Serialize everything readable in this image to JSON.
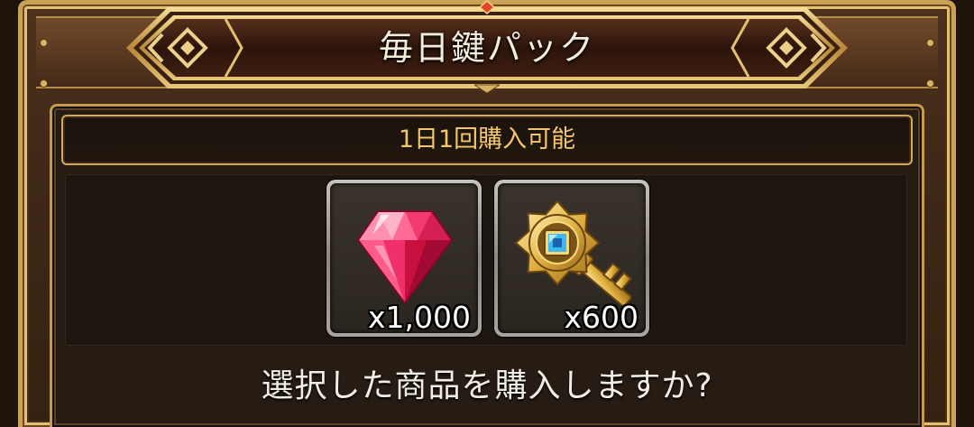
{
  "dialog": {
    "title": "毎日鍵パック",
    "purchase_limit": "1日1回購入可能",
    "items": [
      {
        "icon": "ruby-gem-icon",
        "quantity": "x1,000"
      },
      {
        "icon": "golden-key-icon",
        "quantity": "x600"
      }
    ],
    "confirm_prompt": "選択した商品を購入しますか?"
  },
  "colors": {
    "frame_gold": "#caa257",
    "title_text": "#f4ecdc",
    "limit_text": "#f3c66b",
    "panel_bg": "#261c14",
    "quantity_text": "#ffffff",
    "prompt_text": "#f2ede4"
  }
}
